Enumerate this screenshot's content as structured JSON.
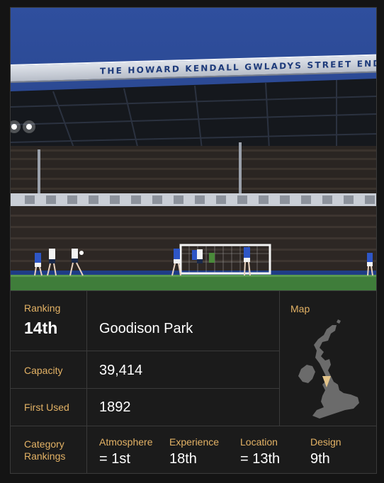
{
  "stadium": {
    "banner_text": "THE HOWARD KENDALL GWLADYS STREET END",
    "name": "Goodison Park"
  },
  "ranking": {
    "label": "Ranking",
    "value": "14th"
  },
  "capacity": {
    "label": "Capacity",
    "value": "39,414"
  },
  "first_used": {
    "label": "First Used",
    "value": "1892"
  },
  "map": {
    "label": "Map",
    "icon": "uk-map-icon",
    "marker_color": "#e3c48a"
  },
  "category_rankings": {
    "label_line1": "Category",
    "label_line2": "Rankings",
    "items": [
      {
        "name": "Atmosphere",
        "value": "= 1st"
      },
      {
        "name": "Experience",
        "value": "18th"
      },
      {
        "name": "Location",
        "value": "= 13th"
      },
      {
        "name": "Design",
        "value": "9th"
      }
    ]
  },
  "colors": {
    "accent": "#e3b265",
    "background": "#1b1b1b",
    "divider": "#3a3a3a"
  }
}
